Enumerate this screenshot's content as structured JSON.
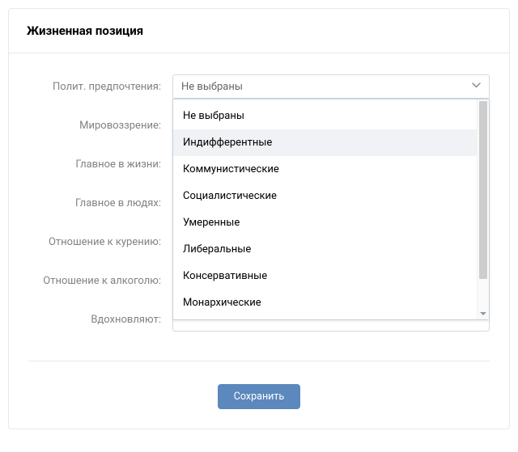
{
  "header": {
    "title": "Жизненная позиция"
  },
  "form": {
    "fields": [
      {
        "label": "Полит. предпочтения:"
      },
      {
        "label": "Мировоззрение:"
      },
      {
        "label": "Главное в жизни:"
      },
      {
        "label": "Главное в людях:"
      },
      {
        "label": "Отношение к курению:"
      },
      {
        "label": "Отношение к алкоголю:"
      },
      {
        "label": "Вдохновляют:"
      }
    ],
    "political": {
      "selected": "Не выбраны",
      "options": [
        "Не выбраны",
        "Индифферентные",
        "Коммунистические",
        "Социалистические",
        "Умеренные",
        "Либеральные",
        "Консервативные",
        "Монархические"
      ],
      "highlighted_index": 1
    }
  },
  "actions": {
    "save": "Сохранить"
  }
}
